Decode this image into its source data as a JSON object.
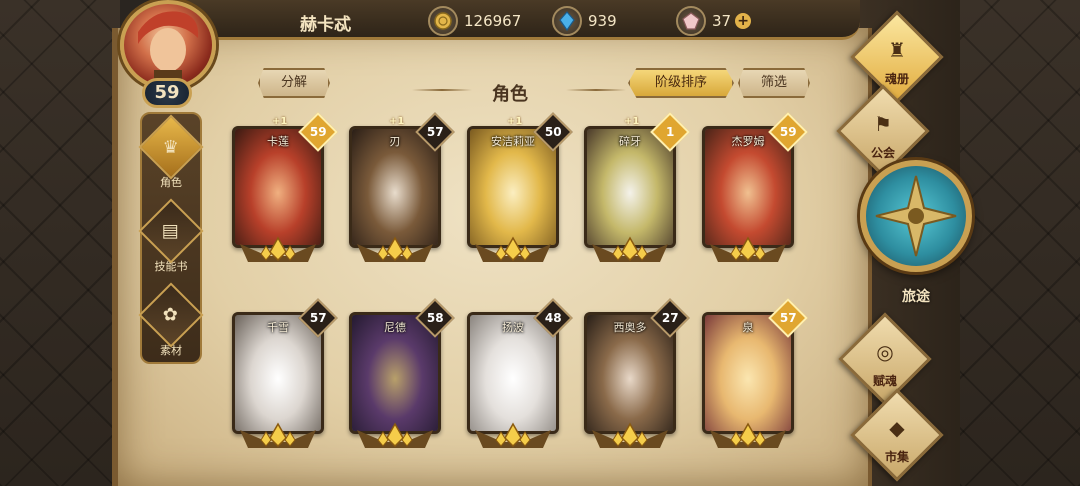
{
  "player": {
    "name": "赫卡忒",
    "level": "59"
  },
  "resources": {
    "gold": "126967",
    "crystal": "939",
    "gem": "37"
  },
  "header": {
    "title": "角色",
    "decompose_label": "分解",
    "sort_label": "阶级排序",
    "filter_label": "筛选"
  },
  "left_menu": {
    "items": [
      {
        "label": "角色"
      },
      {
        "label": "技能书"
      },
      {
        "label": "素材"
      }
    ]
  },
  "right_menu": {
    "items": [
      {
        "label": "魂册"
      },
      {
        "label": "公会"
      },
      {
        "label": "旅途"
      },
      {
        "label": "赋魂"
      },
      {
        "label": "市集"
      }
    ]
  },
  "characters": [
    {
      "name": "卡莲",
      "level": "59",
      "bonus": "+1",
      "colors": [
        "#f0b080",
        "#b8402a",
        "#3a1a12"
      ]
    },
    {
      "name": "刃",
      "level": "57",
      "bonus": "+1",
      "colors": [
        "#e8dccc",
        "#7a5a3a",
        "#2a1e16"
      ]
    },
    {
      "name": "安洁莉亚",
      "level": "50",
      "bonus": "+1",
      "colors": [
        "#fbeec0",
        "#e2b84a",
        "#7a5a20"
      ]
    },
    {
      "name": "碎牙",
      "level": "1",
      "bonus": "+1",
      "colors": [
        "#f4f2ea",
        "#c4b86a",
        "#4a3a2a"
      ]
    },
    {
      "name": "杰罗姆",
      "level": "59",
      "bonus": "",
      "colors": [
        "#f0c090",
        "#c44a30",
        "#4a2418"
      ]
    },
    {
      "name": "千雪",
      "level": "57",
      "bonus": "",
      "colors": [
        "#ffffff",
        "#dcd6d0",
        "#6a625a"
      ]
    },
    {
      "name": "尼德",
      "level": "58",
      "bonus": "",
      "colors": [
        "#b8a06a",
        "#5a3a6a",
        "#241a30"
      ]
    },
    {
      "name": "扬波",
      "level": "48",
      "bonus": "",
      "colors": [
        "#ffffff",
        "#e4e0dc",
        "#8a847e"
      ]
    },
    {
      "name": "西奥多",
      "level": "27",
      "bonus": "",
      "colors": [
        "#e8d8c8",
        "#8a6a4a",
        "#2a2018"
      ]
    },
    {
      "name": "泉",
      "level": "57",
      "bonus": "",
      "colors": [
        "#fbe6b0",
        "#e8b870",
        "#7a3a3a"
      ]
    }
  ]
}
